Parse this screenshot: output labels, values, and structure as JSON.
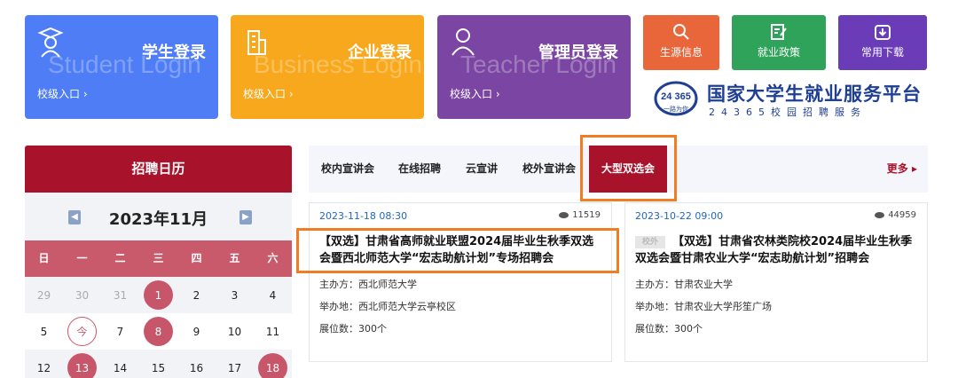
{
  "logins": [
    {
      "title": "学生登录",
      "bg_text": "Student Login",
      "entry": "校级入口 ›",
      "icon": "graduate-icon"
    },
    {
      "title": "企业登录",
      "bg_text": "Business Login",
      "entry": "校级入口 ›",
      "icon": "building-icon"
    },
    {
      "title": "管理员登录",
      "bg_text": "Teacher Login",
      "entry": "校级入口 ›",
      "icon": "admin-user-icon"
    }
  ],
  "quick_links": [
    {
      "label": "生源信息",
      "icon": "search-icon"
    },
    {
      "label": "就业政策",
      "icon": "edit-document-icon"
    },
    {
      "label": "常用下载",
      "icon": "download-icon"
    }
  ],
  "platform": {
    "logo_top": "24 365",
    "logo_bottom": "一路为你",
    "title": "国家大学生就业服务平台",
    "subtitle": "24365校园招聘服务"
  },
  "calendar": {
    "header": "招聘日历",
    "month": "2023年11月",
    "weekdays": [
      "日",
      "一",
      "二",
      "三",
      "四",
      "五",
      "六"
    ],
    "rows": [
      [
        "29",
        "30",
        "31",
        "1",
        "2",
        "3",
        "4"
      ],
      [
        "5",
        "今",
        "7",
        "8",
        "9",
        "10",
        "11"
      ],
      [
        "12",
        "13",
        "14",
        "15",
        "16",
        "17",
        "18"
      ]
    ]
  },
  "tabs": [
    "校内宣讲会",
    "在线招聘",
    "云宣讲",
    "校外宣讲会",
    "大型双选会"
  ],
  "active_tab": "大型双选会",
  "more_label": "更多 ▸",
  "cards": [
    {
      "date": "2023-11-18 08:30",
      "views": "11519",
      "title": "【双选】甘肃省高师就业联盟2024届毕业生秋季双选会暨西北师范大学“宏志助航计划”专场招聘会",
      "organizer": "主办方：西北师范大学",
      "venue": "举办地：西北师范大学云亭校区",
      "booths": "展位数：300个"
    },
    {
      "date": "2023-10-22 09:00",
      "views": "44959",
      "tag": "校外",
      "title": "【双选】甘肃省农林类院校2024届毕业生秋季双选会暨甘肃农业大学“宏志助航计划”招聘会",
      "organizer": "主办方：甘肃农业大学",
      "venue": "举办地：甘肃农业大学彤笙广场",
      "booths": "展位数：300个"
    }
  ],
  "colors": {
    "primary": "#a8122a",
    "highlight": "#f07d24",
    "student": "#4f7df5",
    "business": "#f8a81c",
    "admin": "#7b46a3"
  }
}
